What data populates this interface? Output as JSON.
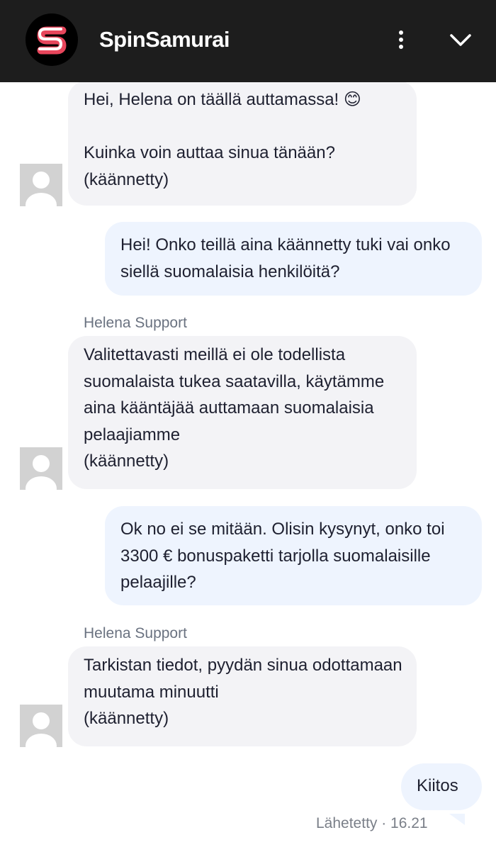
{
  "header": {
    "title": "SpinSamurai",
    "logo_icon": "spin-samurai-logo",
    "menu_icon": "more-vertical-icon",
    "collapse_icon": "chevron-down-icon",
    "background": "#1d1d1d",
    "logo_accent": "#e8465c"
  },
  "messages": [
    {
      "type": "agent",
      "text": "Hei, Helena on täällä auttamassa! 😊\n\nKuinka voin auttaa sinua tänään?\n(käännetty)"
    },
    {
      "type": "user",
      "text": "Hei! Onko teillä aina käännetty tuki vai onko siellä suomalaisia henkilöitä?"
    },
    {
      "type": "agent",
      "sender": "Helena Support",
      "text": "Valitettavasti meillä ei ole todellista suomalaista tukea saatavilla, käytämme aina kääntäjää auttamaan suomalaisia pelaajiamme\n(käännetty)"
    },
    {
      "type": "user",
      "text": "Ok no ei se mitään. Olisin kysynyt, onko toi 3300 € bonuspaketti tarjolla suomalaisille pelaajille?"
    },
    {
      "type": "agent",
      "sender": "Helena Support",
      "text": "Tarkistan tiedot, pyydän sinua odottamaan muutama minuutti\n(käännetty)"
    },
    {
      "type": "user",
      "text": "Kiitos",
      "status": "Lähetetty · 16.21"
    }
  ],
  "colors": {
    "agent_bubble": "#f3f3f6",
    "user_bubble": "#eef4fe",
    "text": "#1e2030",
    "meta_text": "#6a7280"
  }
}
